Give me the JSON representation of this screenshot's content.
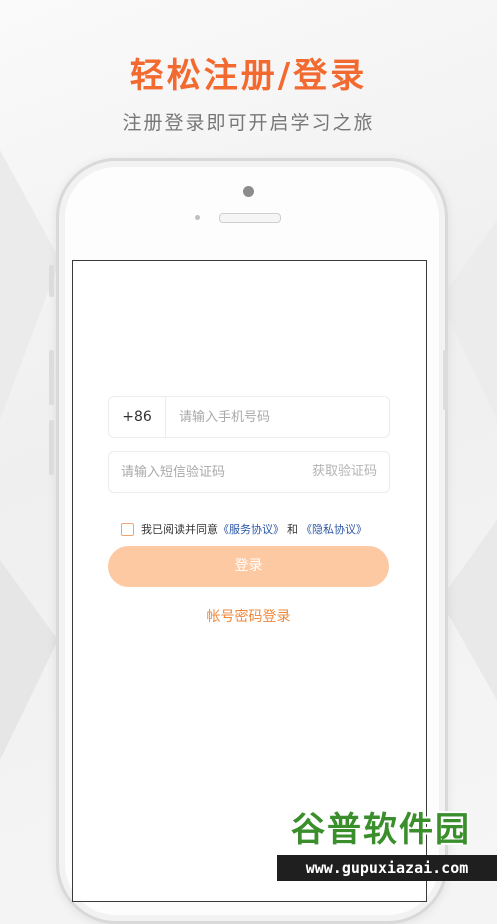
{
  "header": {
    "title": "轻松注册/登录",
    "subtitle": "注册登录即可开启学习之旅"
  },
  "form": {
    "country_code": "+86",
    "phone_placeholder": "请输入手机号码",
    "code_placeholder": "请输入短信验证码",
    "get_code_label": "获取验证码",
    "agreement_prefix": "我已阅读并同意",
    "service_link": "《服务协议》",
    "and_text": "和",
    "privacy_link": "《隐私协议》",
    "login_label": "登录",
    "alt_login_label": "帐号密码登录"
  },
  "watermark": {
    "name": "谷普软件园",
    "url": "www.gupuxiazai.com"
  },
  "colors": {
    "accent": "#f26a2f",
    "button_bg": "#fdc9a3",
    "link": "#2b56a5",
    "alt_link": "#f0883c",
    "watermark_green": "#3a8f2c"
  },
  "icons": {
    "checkbox": "checkbox-unchecked-icon"
  }
}
